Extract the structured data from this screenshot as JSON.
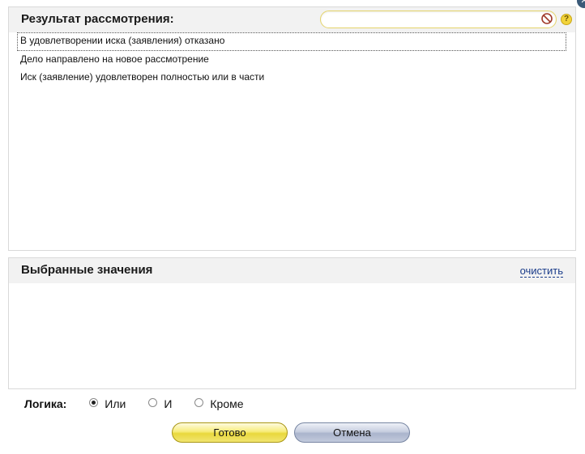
{
  "top_panel": {
    "title": "Результат рассмотрения:",
    "search": {
      "value": "",
      "placeholder": ""
    },
    "help_symbol": "?",
    "options": [
      "В удовлетворении иска (заявления) отказано",
      "Дело направлено на новое рассмотрение",
      "Иск (заявление) удовлетворен полностью или в части"
    ]
  },
  "bottom_panel": {
    "title": "Выбранные значения",
    "clear_label": "очистить"
  },
  "logic": {
    "label": "Логика:",
    "options": [
      "Или",
      "И",
      "Кроме"
    ],
    "selected": "Или"
  },
  "buttons": {
    "ok_label": "Готово",
    "cancel_label": "Отмена"
  },
  "colors": {
    "search_border": "#e5d46a",
    "ok_button": "#f1e570",
    "cancel_button": "#aab4cc",
    "link": "#1a3c8a"
  }
}
